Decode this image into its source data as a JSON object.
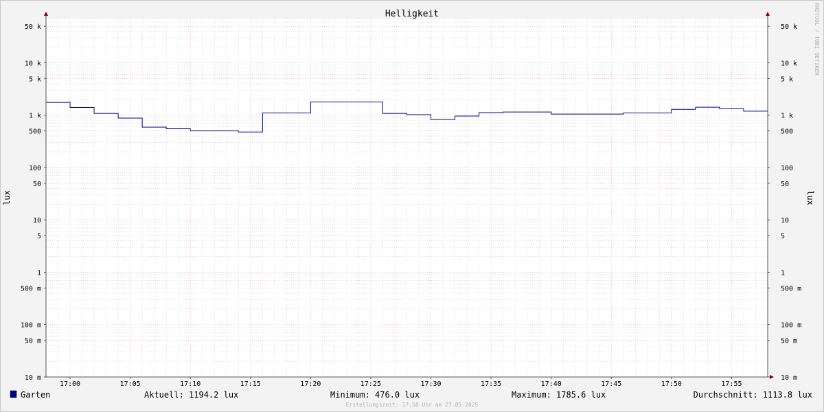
{
  "chart_data": {
    "type": "line",
    "title": "Helligkeit",
    "ylabel": "lux",
    "ylabel_right": "lux",
    "yscale": "log",
    "ylim": [
      0.01,
      70000
    ],
    "x_start": "16:58",
    "x_end": "17:58",
    "x_tick_labels": [
      "17:00",
      "17:05",
      "17:10",
      "17:15",
      "17:20",
      "17:25",
      "17:30",
      "17:35",
      "17:40",
      "17:45",
      "17:50",
      "17:55"
    ],
    "y_major_ticks": [
      {
        "value": 0.01,
        "label": "10 m"
      },
      {
        "value": 0.05,
        "label": "50 m"
      },
      {
        "value": 0.1,
        "label": "100 m"
      },
      {
        "value": 0.5,
        "label": "500 m"
      },
      {
        "value": 1,
        "label": "1"
      },
      {
        "value": 5,
        "label": "5"
      },
      {
        "value": 10,
        "label": "10"
      },
      {
        "value": 50,
        "label": "50"
      },
      {
        "value": 100,
        "label": "100"
      },
      {
        "value": 500,
        "label": "500"
      },
      {
        "value": 1000,
        "label": "1 k"
      },
      {
        "value": 5000,
        "label": "5 k"
      },
      {
        "value": 10000,
        "label": "10 k"
      },
      {
        "value": 50000,
        "label": "50 k"
      }
    ],
    "grid": true,
    "colors": {
      "series": "#00008b",
      "grid_major": "#e89999",
      "grid_minor": "#c8c8c8",
      "axis": "#555555",
      "arrow": "#8b0000"
    },
    "series": [
      {
        "name": "Garten",
        "color": "#00008b",
        "x": [
          "16:58",
          "17:00",
          "17:02",
          "17:04",
          "17:06",
          "17:08",
          "17:10",
          "17:12",
          "17:14",
          "17:16",
          "17:18",
          "17:20",
          "17:22",
          "17:24",
          "17:26",
          "17:28",
          "17:30",
          "17:32",
          "17:34",
          "17:36",
          "17:38",
          "17:40",
          "17:42",
          "17:44",
          "17:46",
          "17:48",
          "17:50",
          "17:52",
          "17:54",
          "17:56"
        ],
        "values": [
          1750,
          1400,
          1080,
          880,
          590,
          550,
          500,
          500,
          476,
          1100,
          1100,
          1785.6,
          1785.6,
          1785.6,
          1080,
          1020,
          830,
          960,
          1120,
          1150,
          1150,
          1050,
          1050,
          1050,
          1100,
          1100,
          1290,
          1420,
          1320,
          1194.2
        ]
      }
    ],
    "legend": "bottom-left"
  },
  "legend": {
    "series_name": "Garten",
    "aktuell": "Aktuell: 1194.2 lux",
    "minimum": "Minimum: 476.0 lux",
    "maximum": "Maximum: 1785.6 lux",
    "durchschnitt": "Durchschnitt: 1113.8 lux"
  },
  "footer": "Erstellungszeit: 17:58 Uhr am 27.05.2025",
  "watermark": "RRDTOOL / TOBI OETIKER"
}
